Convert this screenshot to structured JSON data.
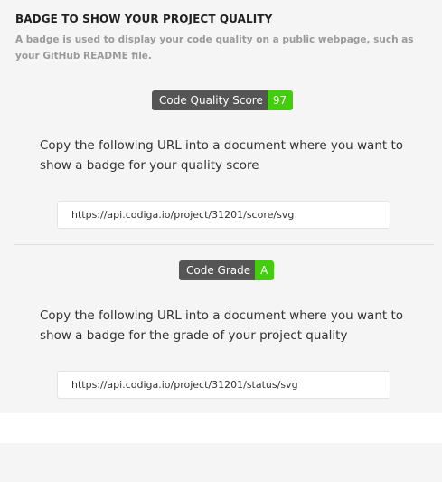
{
  "header": {
    "title": "BADGE TO SHOW YOUR PROJECT QUALITY",
    "description": "A badge is used to display your code quality on a public webpage, such as your GitHub README file."
  },
  "quality_badge": {
    "label": "Code Quality Score",
    "value": "97",
    "label_color": "#555555",
    "value_color": "#44cc11"
  },
  "quality_section": {
    "instruction": "Copy the following URL into a document where you want to show a badge for your quality score",
    "url": "https://api.codiga.io/project/31201/score/svg"
  },
  "grade_badge": {
    "label": "Code Grade",
    "value": "A",
    "label_color": "#555555",
    "value_color": "#44cc11"
  },
  "grade_section": {
    "instruction": "Copy the following URL into a document where you want to show a badge for the grade of your project quality",
    "url": "https://api.codiga.io/project/31201/status/svg"
  }
}
